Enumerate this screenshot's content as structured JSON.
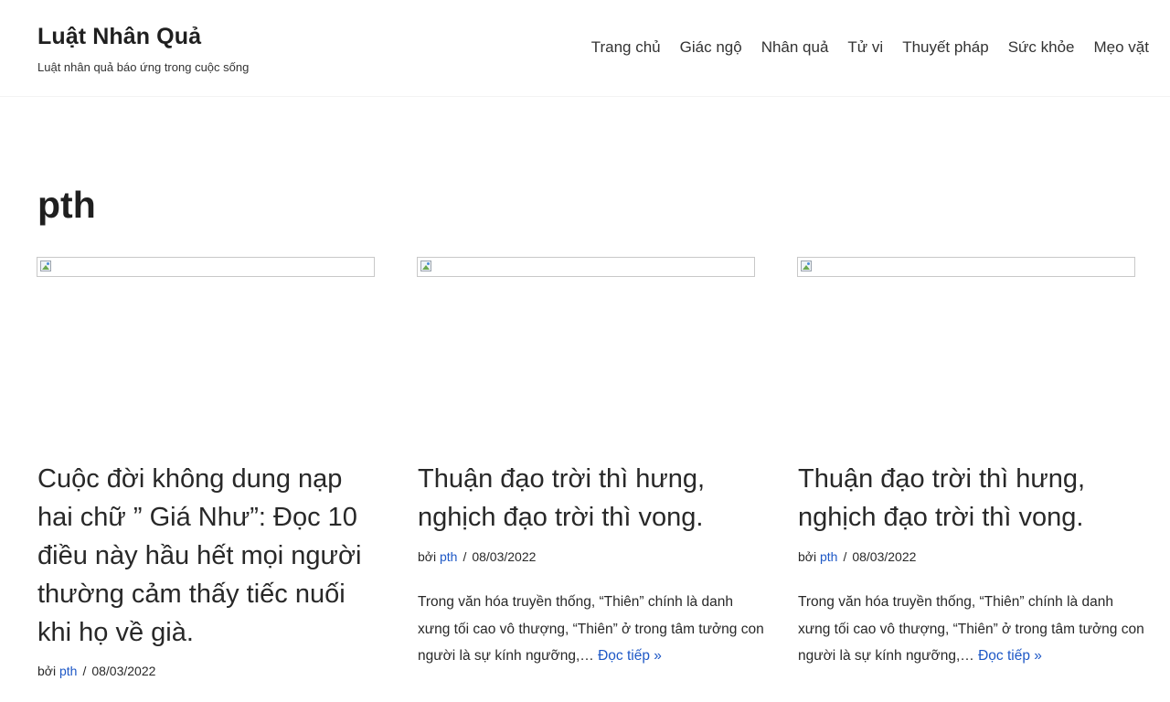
{
  "site": {
    "title": "Luật Nhân Quả",
    "tagline": "Luật nhân quả báo ứng trong cuộc sống"
  },
  "nav": {
    "items": [
      "Trang chủ",
      "Giác ngộ",
      "Nhân quả",
      "Tử vi",
      "Thuyết pháp",
      "Sức khỏe",
      "Mẹo vặt"
    ]
  },
  "page": {
    "heading": "pth"
  },
  "posts": [
    {
      "title": "Cuộc đời không dung nạp hai chữ ” Giá Như”: Đọc 10 điều này hầu hết mọi người thường cảm thấy tiếc nuối khi họ về già.",
      "by": "bởi",
      "author": "pth",
      "sep": "/",
      "date": "08/03/2022"
    },
    {
      "title": "Thuận đạo trời thì hưng, nghịch đạo trời thì vong.",
      "by": "bởi",
      "author": "pth",
      "sep": "/",
      "date": "08/03/2022",
      "excerpt": "Trong văn hóa truyền thống, “Thiên” chính là danh xưng tối cao vô thượng, “Thiên” ở trong tâm tưởng con người là sự kính ngưỡng,…",
      "readmore": "Đọc tiếp »"
    },
    {
      "title": "Thuận đạo trời thì hưng, nghịch đạo trời thì vong.",
      "by": "bởi",
      "author": "pth",
      "sep": "/",
      "date": "08/03/2022",
      "excerpt": "Trong văn hóa truyền thống, “Thiên” chính là danh xưng tối cao vô thượng, “Thiên” ở trong tâm tưởng con người là sự kính ngưỡng,…",
      "readmore": "Đọc tiếp »"
    }
  ],
  "colors": {
    "link": "#1e58c6",
    "text": "#282828"
  }
}
